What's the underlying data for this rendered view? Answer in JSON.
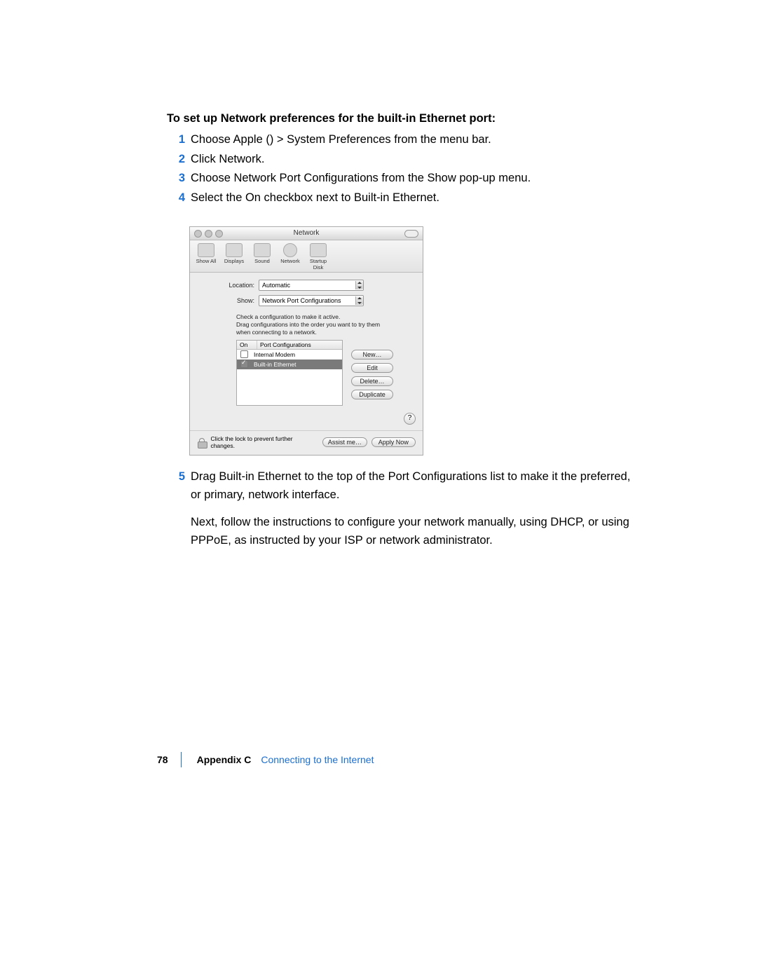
{
  "heading": "To set up Network preferences for the built-in Ethernet port:",
  "steps": [
    {
      "num": "1",
      "text_pre": "Choose Apple (",
      "glyph": "",
      "text_post": ") > System Preferences from the menu bar."
    },
    {
      "num": "2",
      "text": "Click Network."
    },
    {
      "num": "3",
      "text": "Choose Network Port Configurations from the Show pop-up menu."
    },
    {
      "num": "4",
      "text": "Select the On checkbox next to Built-in Ethernet."
    }
  ],
  "syswin": {
    "title": "Network",
    "toolbar": [
      {
        "label": "Show All"
      },
      {
        "label": "Displays"
      },
      {
        "label": "Sound"
      },
      {
        "label": "Network"
      },
      {
        "label": "Startup Disk"
      }
    ],
    "location_label": "Location:",
    "location_value": "Automatic",
    "show_label": "Show:",
    "show_value": "Network Port Configurations",
    "instruction": "Check a configuration to make it active.\nDrag configurations into the order you want to try them when connecting to a network.",
    "col_on": "On",
    "col_name": "Port Configurations",
    "rows": [
      {
        "checked": false,
        "name": "Internal Modem",
        "selected": false
      },
      {
        "checked": true,
        "name": "Built-in Ethernet",
        "selected": true
      }
    ],
    "buttons": {
      "new": "New…",
      "edit": "Edit",
      "delete": "Delete…",
      "duplicate": "Duplicate"
    },
    "help": "?",
    "lock_text": "Click the lock to prevent further changes.",
    "assist": "Assist me…",
    "apply": "Apply Now"
  },
  "step5": {
    "num": "5",
    "text": "Drag Built-in Ethernet to the top of the Port Configurations list to make it the preferred, or primary, network interface."
  },
  "para_after": "Next, follow the instructions to configure your network manually, using DHCP, or using PPPoE, as instructed by your ISP or network administrator.",
  "footer": {
    "page": "78",
    "appendix": "Appendix C",
    "title": "Connecting to the Internet"
  }
}
